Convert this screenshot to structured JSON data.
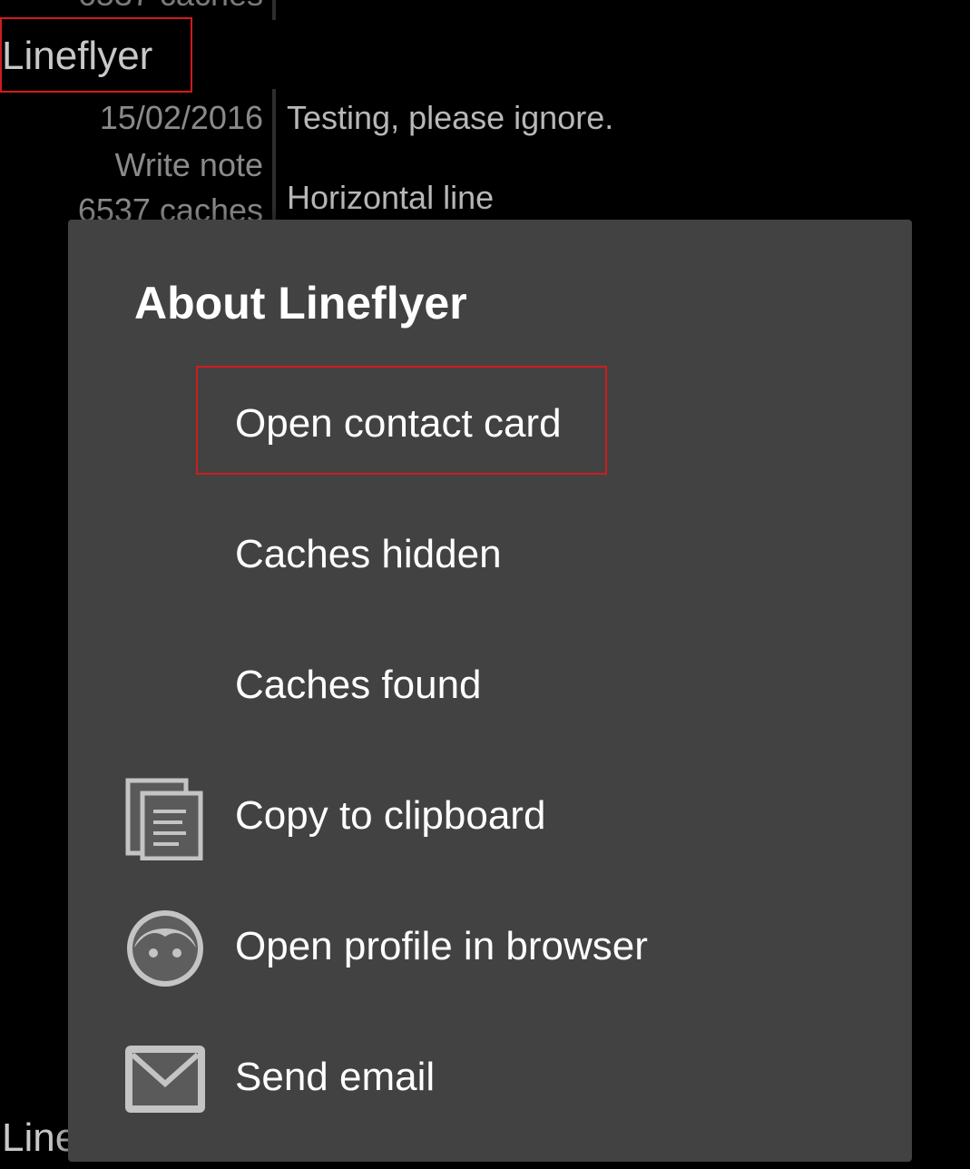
{
  "background_log": {
    "top_clipped_count": "6537 caches",
    "author": "Lineflyer",
    "entry": {
      "date": "15/02/2016",
      "type": "Write note",
      "caches": "6537 caches",
      "text_line1": "Testing, please ignore.",
      "text_line2": "Horizontal line"
    },
    "next_author_partial": "Line"
  },
  "dialog": {
    "title": "About Lineflyer",
    "items": [
      {
        "label": "Open contact card",
        "icon": null
      },
      {
        "label": "Caches hidden",
        "icon": null
      },
      {
        "label": "Caches found",
        "icon": null
      },
      {
        "label": "Copy to clipboard",
        "icon": "copy-icon"
      },
      {
        "label": "Open profile in browser",
        "icon": "profile-face-icon"
      },
      {
        "label": "Send email",
        "icon": "envelope-icon"
      }
    ]
  },
  "colors": {
    "background": "#000000",
    "dialog_background": "#424242",
    "highlight_border": "#d01c1c",
    "text_primary": "#ffffff",
    "text_muted": "#8a8a8a"
  }
}
